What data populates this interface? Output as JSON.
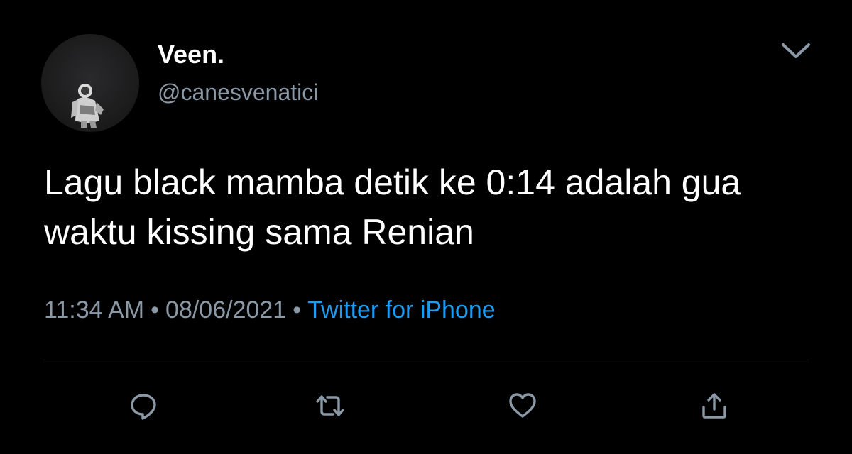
{
  "author": {
    "display_name": "Veen.",
    "handle": "@canesvenatici"
  },
  "tweet": {
    "text": "Lagu black mamba detik ke 0:14 adalah gua waktu kissing sama Renian"
  },
  "meta": {
    "time": "11:34 AM",
    "separator": "•",
    "date": "08/06/2021",
    "source": "Twitter for iPhone"
  },
  "icons": {
    "more": "chevron-down-icon",
    "reply": "reply-icon",
    "retweet": "retweet-icon",
    "like": "heart-icon",
    "share": "share-icon"
  },
  "colors": {
    "background": "#000000",
    "primary_text": "#ffffff",
    "secondary_text": "#8b98a5",
    "link": "#1d9bf0",
    "divider": "#2f3336"
  }
}
